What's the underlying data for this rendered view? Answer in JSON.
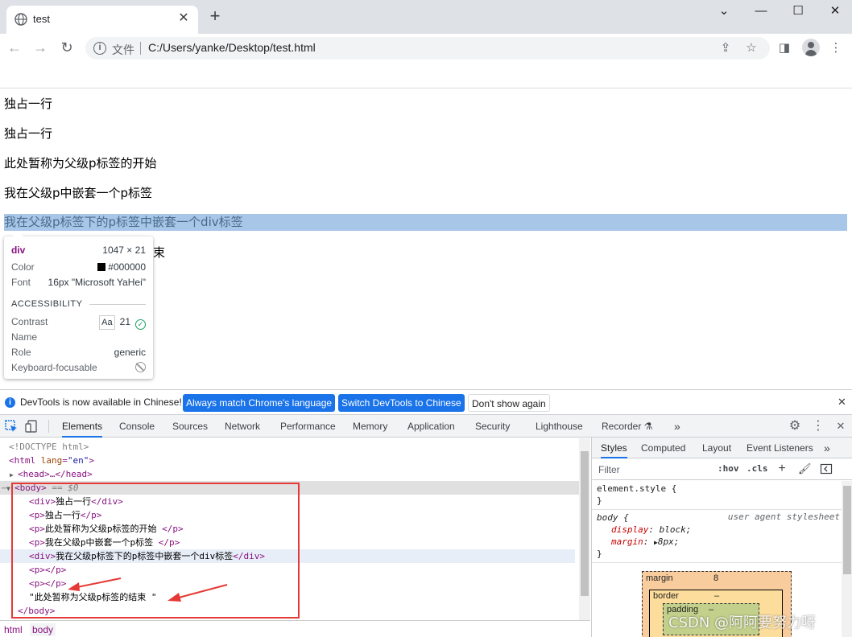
{
  "window": {
    "tab_title": "test",
    "tab_close_glyph": "✕",
    "new_tab_glyph": "+",
    "controls": {
      "collapse": "⌄",
      "minimize": "—",
      "maximize": "☐",
      "close": "✕"
    }
  },
  "toolbar": {
    "back_glyph": "←",
    "forward_glyph": "→",
    "reload_glyph": "↻",
    "info_glyph": "i",
    "file_label": "文件",
    "url": "C:/Users/yanke/Desktop/test.html",
    "share_glyph": "⇪",
    "star_glyph": "☆",
    "sidepanel_glyph": "◨",
    "menu_glyph": "⋮"
  },
  "page": {
    "lines": [
      "独占一行",
      "独占一行",
      "此处暂称为父级p标签的开始",
      "我在父级p中嵌套一个p标签",
      "我在父级p标签下的p标签中嵌套一个div标签",
      "束"
    ]
  },
  "tooltip": {
    "tag": "div",
    "size": "1047 × 21",
    "color_label": "Color",
    "color_value": "#000000",
    "font_label": "Font",
    "font_value": "16px \"Microsoft YaHei\"",
    "section": "ACCESSIBILITY",
    "contrast_label": "Contrast",
    "contrast_aa": "Aa",
    "contrast_value": "21",
    "name_label": "Name",
    "role_label": "Role",
    "role_value": "generic",
    "kb_label": "Keyboard-focusable"
  },
  "devtools": {
    "infobar": {
      "text": "DevTools is now available in Chinese!",
      "btn_match": "Always match Chrome's language",
      "btn_switch": "Switch DevTools to Chinese",
      "btn_dismiss": "Don't show again",
      "close_glyph": "✕"
    },
    "tabs": [
      "Elements",
      "Console",
      "Sources",
      "Network",
      "Performance",
      "Memory",
      "Application",
      "Security",
      "Lighthouse",
      "Recorder ⚗"
    ],
    "more_glyph": "»",
    "gear_glyph": "⚙",
    "kebab_glyph": "⋮",
    "close_glyph": "✕",
    "dom": {
      "doctype": "<!DOCTYPE html>",
      "html_open_tag": "<html",
      "html_attr": "lang",
      "html_attr_val": "\"en\"",
      "head": "<head>…</head>",
      "body_open": "<body>",
      "body_eq": "== $0",
      "rows": [
        {
          "open": "<div>",
          "text": "独占一行",
          "close": "</div>"
        },
        {
          "open": "<p>",
          "text": "独占一行",
          "close": "</p>"
        },
        {
          "open": "<p>",
          "text": "此处暂称为父级p标签的开始 ",
          "close": "</p>"
        },
        {
          "open": "<p>",
          "text": "我在父级p中嵌套一个p标签 ",
          "close": "</p>"
        },
        {
          "open": "<div>",
          "text": "我在父级p标签下的p标签中嵌套一个div标签",
          "close": "</div>"
        },
        {
          "open": "<p>",
          "text": "",
          "close": "</p>"
        },
        {
          "open": "<p>",
          "text": "",
          "close": "</p>"
        }
      ],
      "text_node": "\"此处暂称为父级p标签的结束 \"",
      "body_close": "</body>",
      "dots": "⋯"
    },
    "breadcrumbs": [
      "html",
      "body"
    ],
    "styles": {
      "tabs": [
        "Styles",
        "Computed",
        "Layout",
        "Event Listeners"
      ],
      "more_glyph": "»",
      "filter_placeholder": "Filter",
      "hov": ":hov",
      "cls": ".cls",
      "plus_glyph": "+",
      "element_style": "element.style {",
      "close_brace": "}",
      "body_selector": "body {",
      "ua_label": "user agent stylesheet",
      "display_prop": "display",
      "display_val": "block;",
      "margin_prop": "margin",
      "margin_val": "8px;",
      "box_margin_label": "margin",
      "box_margin_val": "8",
      "box_border_label": "border",
      "box_border_val": "–",
      "box_padding_label": "padding",
      "box_padding_val": "–"
    }
  },
  "watermark": "CSDN @阿阿要努力呀"
}
